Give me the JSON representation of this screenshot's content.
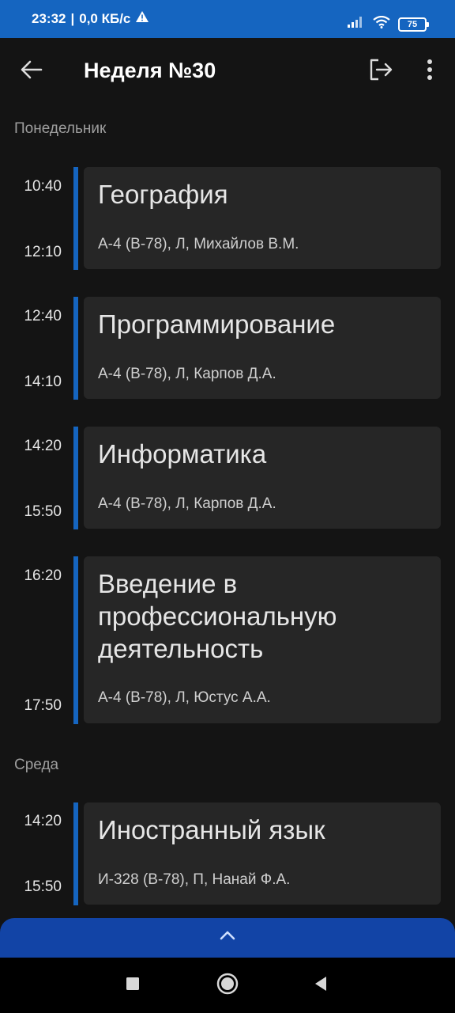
{
  "status_bar": {
    "time": "23:32",
    "speed": "0,0 КБ/с",
    "battery": "75",
    "icons": [
      "warning-icon",
      "signal-icon",
      "wifi-icon",
      "battery-icon"
    ]
  },
  "app_bar": {
    "title": "Неделя №30",
    "icons": [
      "back-arrow-icon",
      "logout-icon",
      "more-vert-icon"
    ]
  },
  "days": [
    {
      "name": "Понедельник",
      "lessons": [
        {
          "start": "10:40",
          "end": "12:10",
          "title": "География",
          "details": "А-4 (В-78), Л, Михайлов В.М."
        },
        {
          "start": "12:40",
          "end": "14:10",
          "title": "Программирование",
          "details": "А-4 (В-78), Л, Карпов Д.А."
        },
        {
          "start": "14:20",
          "end": "15:50",
          "title": "Информатика",
          "details": "А-4 (В-78), Л, Карпов Д.А."
        },
        {
          "start": "16:20",
          "end": "17:50",
          "title": "Введение в профессиональную деятельность",
          "details": "А-4 (В-78), Л, Юстус А.А."
        }
      ]
    },
    {
      "name": "Среда",
      "lessons": [
        {
          "start": "14:20",
          "end": "15:50",
          "title": "Иностранный язык",
          "details": "И-328 (В-78), П, Нанай Ф.А."
        }
      ]
    }
  ],
  "bottom_sheet": {
    "icon": "chevron-up-icon"
  },
  "nav_bar": {
    "icons": [
      "recents-square-icon",
      "home-circle-icon",
      "back-triangle-icon"
    ]
  },
  "colors": {
    "accent": "#1565c0",
    "background": "#141414",
    "card": "#262626",
    "sheet": "#1244a6"
  }
}
